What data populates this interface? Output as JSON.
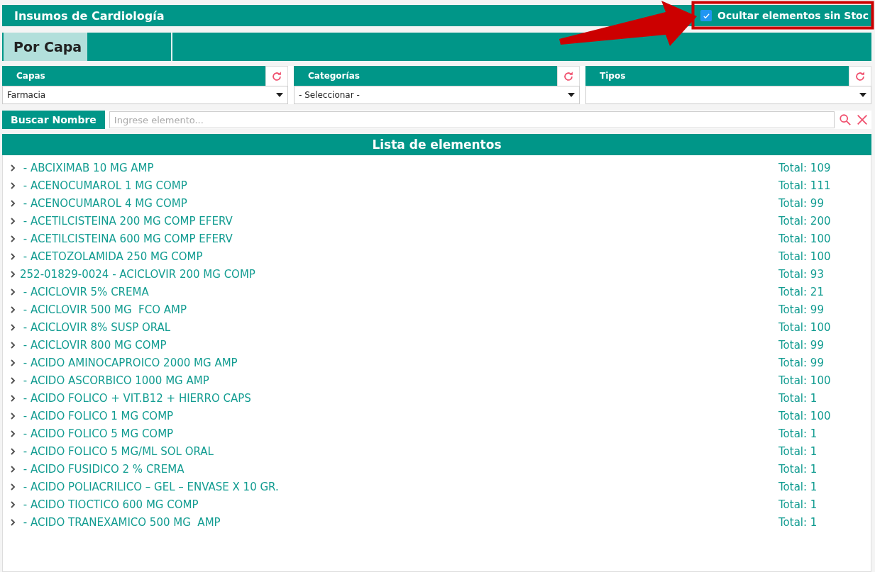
{
  "window": {
    "title": "Insumos de Cardiología"
  },
  "hide_without_stock": {
    "label": "Ocultar elementos sin Stoc",
    "checked": true
  },
  "annotation": {
    "kind": "arrow"
  },
  "tabs": [
    {
      "label": "Por Capa",
      "selected": true
    }
  ],
  "filters": [
    {
      "label": "Capas",
      "value": "Farmacia"
    },
    {
      "label": "Categorías",
      "value": "- Seleccionar -"
    },
    {
      "label": "Tipos"
    }
  ],
  "search": {
    "label": "Buscar Nombre",
    "placeholder": "Ingrese elemento..."
  },
  "list": {
    "title": "Lista de elementos",
    "items": [
      {
        "name": "- ABCIXIMAB 10 MG AMP",
        "total": "Total: 109"
      },
      {
        "name": "- ACENOCUMAROL 1 MG COMP",
        "total": "Total: 111"
      },
      {
        "name": "- ACENOCUMAROL 4 MG COMP",
        "total": "Total: 99"
      },
      {
        "name": "- ACETILCISTEINA 200 MG COMP EFERV",
        "total": "Total: 200"
      },
      {
        "name": "- ACETILCISTEINA 600 MG COMP EFERV",
        "total": "Total: 100"
      },
      {
        "name": "- ACETOZOLAMIDA 250 MG COMP",
        "total": "Total: 100"
      },
      {
        "code": "252-01829-0024",
        "name": "- ACICLOVIR 200 MG COMP",
        "total": "Total: 93"
      },
      {
        "name": "- ACICLOVIR 5% CREMA",
        "total": "Total: 21"
      },
      {
        "name": "- ACICLOVIR 500 MG  FCO AMP",
        "total": "Total: 99"
      },
      {
        "name": "- ACICLOVIR 8% SUSP ORAL",
        "total": "Total: 100"
      },
      {
        "name": "- ACICLOVIR 800 MG COMP",
        "total": "Total: 99"
      },
      {
        "name": "- ACIDO AMINOCAPROICO 2000 MG AMP",
        "total": "Total: 99"
      },
      {
        "name": "- ACIDO ASCORBICO 1000 MG AMP",
        "total": "Total: 100"
      },
      {
        "name": "- ACIDO FOLICO + VIT.B12 + HIERRO CAPS",
        "total": "Total: 1"
      },
      {
        "name": "- ACIDO FOLICO 1 MG COMP",
        "total": "Total: 100"
      },
      {
        "name": "- ACIDO FOLICO 5 MG COMP",
        "total": "Total: 1"
      },
      {
        "name": "- ACIDO FOLICO 5 MG/ML SOL ORAL",
        "total": "Total: 1"
      },
      {
        "name": "- ACIDO FUSIDICO 2 % CREMA",
        "total": "Total: 1"
      },
      {
        "name": "- ACIDO POLIACRILICO – GEL – ENVASE X 10 GR.",
        "total": "Total: 1"
      },
      {
        "name": "- ACIDO TIOCTICO 600 MG COMP",
        "total": "Total: 1"
      },
      {
        "name": "- ACIDO TRANEXAMICO 500 MG  AMP",
        "total": "Total: 1"
      }
    ]
  }
}
